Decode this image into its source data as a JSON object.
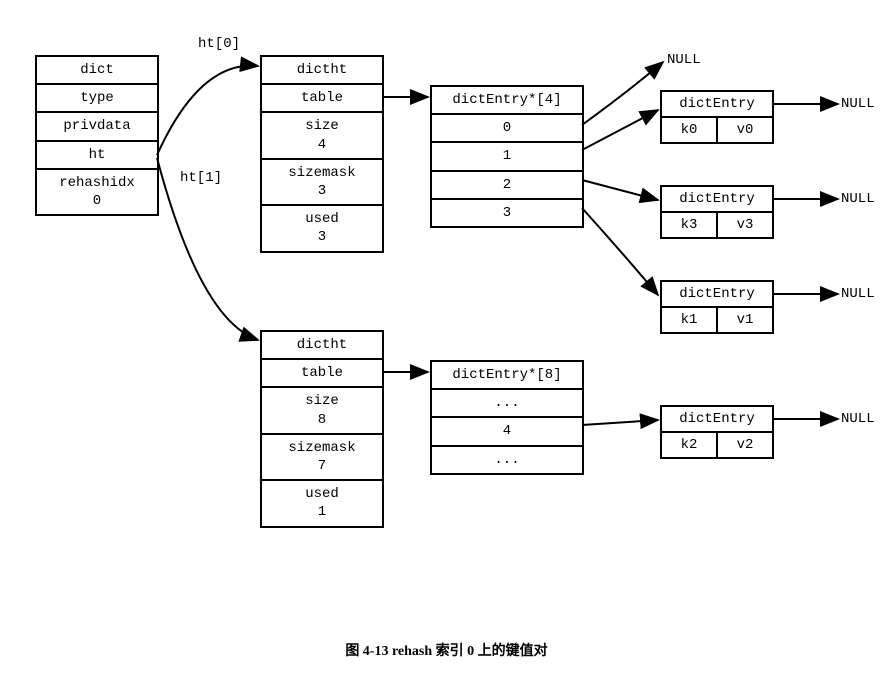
{
  "labels": {
    "ht0": "ht[0]",
    "ht1": "ht[1]",
    "null_top": "NULL",
    "null1": "NULL",
    "null2": "NULL",
    "null3": "NULL",
    "null4": "NULL"
  },
  "dict": {
    "title": "dict",
    "type": "type",
    "privdata": "privdata",
    "ht": "ht",
    "rehashidx_label": "rehashidx",
    "rehashidx_value": "0"
  },
  "ht0_struct": {
    "title": "dictht",
    "table": "table",
    "size_label": "size",
    "size_value": "4",
    "sizemask_label": "sizemask",
    "sizemask_value": "3",
    "used_label": "used",
    "used_value": "3"
  },
  "ht1_struct": {
    "title": "dictht",
    "table": "table",
    "size_label": "size",
    "size_value": "8",
    "sizemask_label": "sizemask",
    "sizemask_value": "7",
    "used_label": "used",
    "used_value": "1"
  },
  "arr0": {
    "header": "dictEntry*[4]",
    "i0": "0",
    "i1": "1",
    "i2": "2",
    "i3": "3"
  },
  "arr1": {
    "header": "dictEntry*[8]",
    "dots1": "...",
    "i4": "4",
    "dots2": "..."
  },
  "entries": {
    "e0": {
      "title": "dictEntry",
      "k": "k0",
      "v": "v0"
    },
    "e1": {
      "title": "dictEntry",
      "k": "k3",
      "v": "v3"
    },
    "e2": {
      "title": "dictEntry",
      "k": "k1",
      "v": "v1"
    },
    "e3": {
      "title": "dictEntry",
      "k": "k2",
      "v": "v2"
    }
  },
  "caption": "图 4-13   rehash 索引 0 上的键值对"
}
